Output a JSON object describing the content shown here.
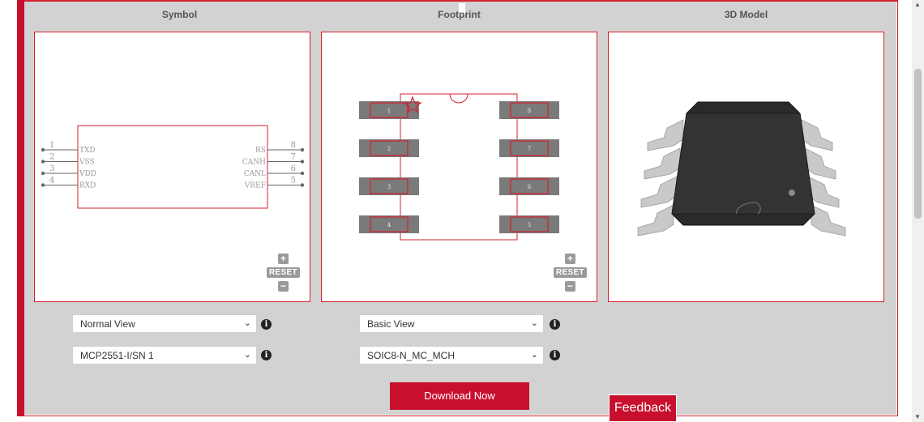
{
  "columns": {
    "symbol": "Symbol",
    "footprint": "Footprint",
    "model3d": "3D Model"
  },
  "symbol": {
    "left_pins": [
      {
        "num": "1",
        "name": "TXD"
      },
      {
        "num": "2",
        "name": "VSS"
      },
      {
        "num": "3",
        "name": "VDD"
      },
      {
        "num": "4",
        "name": "RXD"
      }
    ],
    "right_pins": [
      {
        "num": "8",
        "name": "RS"
      },
      {
        "num": "7",
        "name": "CANH"
      },
      {
        "num": "6",
        "name": "CANL"
      },
      {
        "num": "5",
        "name": "VREF"
      }
    ]
  },
  "footprint": {
    "left_pads": [
      "1",
      "2",
      "3",
      "4"
    ],
    "right_pads": [
      "8",
      "7",
      "6",
      "5"
    ]
  },
  "zoom": {
    "plus": "+",
    "reset": "RESET",
    "minus": "−"
  },
  "controls": {
    "symbol_view": "Normal View",
    "symbol_part": "MCP2551-I/SN 1",
    "footprint_view": "Basic View",
    "footprint_name": "SOIC8-N_MC_MCH",
    "info": "i",
    "chevron": "⌄"
  },
  "download_label": "Download Now",
  "feedback_label": "Feedback",
  "colors": {
    "accent": "#c8102e",
    "panel_bg": "#d2d2d2"
  }
}
